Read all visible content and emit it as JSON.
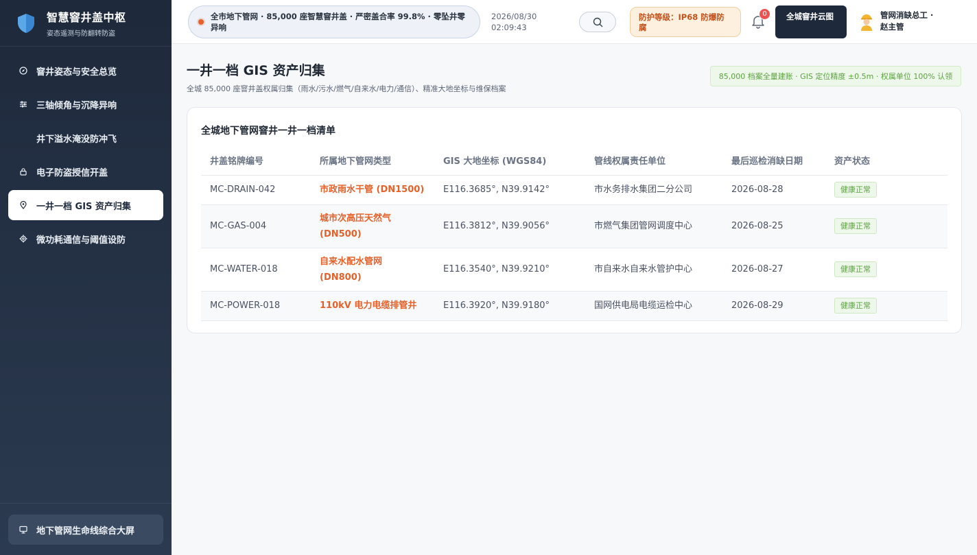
{
  "brand": {
    "title": "智慧窨井盖中枢",
    "subtitle": "姿态遥测与防翻转防盗",
    "logo_icon": "shield-icon"
  },
  "sidebar": {
    "items": [
      {
        "label": "窨井姿态与安全总览",
        "icon": "compass-icon",
        "active": false
      },
      {
        "label": "三轴倾角与沉降异响",
        "icon": "sliders-icon",
        "active": false
      },
      {
        "label": "井下溢水淹没防冲飞",
        "icon": "",
        "active": false
      },
      {
        "label": "电子防盗授信开盖",
        "icon": "lock-icon",
        "active": false
      },
      {
        "label": "一井一档 GIS 资产归集",
        "icon": "map-pin-icon",
        "active": true
      },
      {
        "label": "微功耗通信与阈值设防",
        "icon": "gear-icon",
        "active": false
      }
    ],
    "footer_label": "地下管网生命线综合大屏",
    "footer_icon": "monitor-icon"
  },
  "header": {
    "ticker": "全市地下管网 · 85,000 座智慧窨井盖 · 严密盖合率 99.8% · 零坠井零异响",
    "date": "2026/08/30",
    "time": "02:09:43",
    "protection": "防护等级：IP68 防爆防腐",
    "notifications": "0",
    "cloud_button": "全城窨井云图",
    "user_name": "管网消缺总工 · 赵主管"
  },
  "page": {
    "title": "一井一档 GIS 资产归集",
    "subtitle": "全城 85,000 座窨井盖权属归集（雨水/污水/燃气/自来水/电力/通信）、精准大地坐标与维保档案",
    "accuracy_badge": "85,000 档案全量建账 · GIS 定位精度 ±0.5m · 权属单位 100% 认领"
  },
  "table": {
    "title": "全城地下管网窨井一井一档清单",
    "columns": [
      "井盖铭牌编号",
      "所属地下管网类型",
      "GIS 大地坐标 (WGS84)",
      "管线权属责任单位",
      "最后巡检消缺日期",
      "资产状态"
    ],
    "rows": [
      {
        "id": "MC-DRAIN-042",
        "pipe_line1": "市政雨水干管 (DN1500)",
        "pipe_line2": "",
        "coord": "E116.3685°, N39.9142°",
        "owner": "市水务排水集团二分公司",
        "date": "2026-08-28",
        "status": "健康正常"
      },
      {
        "id": "MC-GAS-004",
        "pipe_line1": "城市次高压天然气",
        "pipe_line2": "(DN500)",
        "coord": "E116.3812°, N39.9056°",
        "owner": "市燃气集团管网调度中心",
        "date": "2026-08-25",
        "status": "健康正常"
      },
      {
        "id": "MC-WATER-018",
        "pipe_line1": "自来水配水管网",
        "pipe_line2": "(DN800)",
        "coord": "E116.3540°, N39.9210°",
        "owner": "市自来水自来水管护中心",
        "date": "2026-08-27",
        "status": "健康正常"
      },
      {
        "id": "MC-POWER-018",
        "pipe_line1": "110kV 电力电缆排管井",
        "pipe_line2": "",
        "coord": "E116.3920°, N39.9180°",
        "owner": "国网供电局电缆运检中心",
        "date": "2026-08-29",
        "status": "健康正常"
      }
    ]
  },
  "colors": {
    "sidebar_bg": "#1e293b",
    "accent_orange": "#e5612a",
    "status_green": "#5aa23f"
  }
}
